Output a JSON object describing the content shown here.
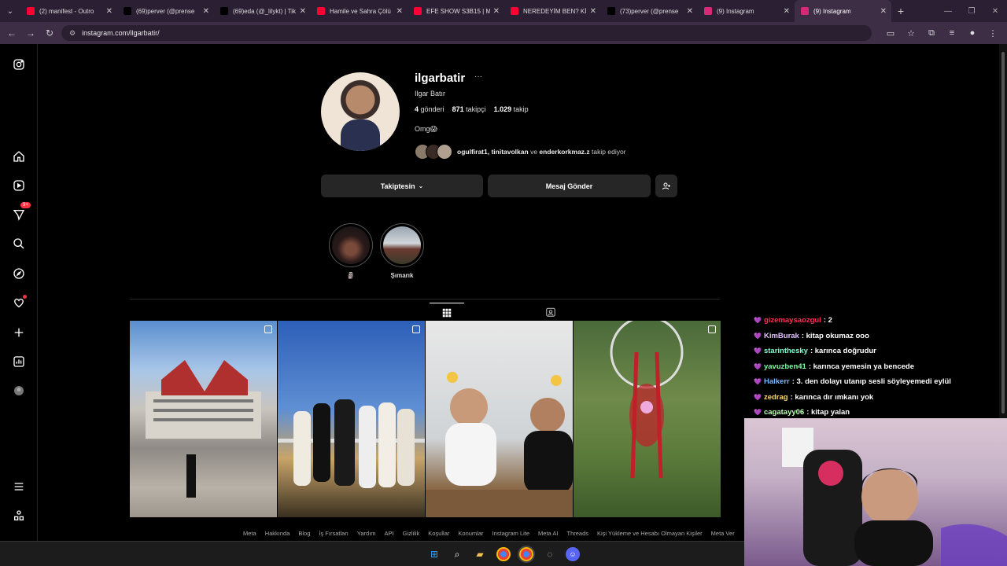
{
  "browser": {
    "tabs": [
      {
        "title": "(2) manifest - Outro",
        "favicon_color": "#ff0033",
        "active": false
      },
      {
        "title": "(69)perver (@prense",
        "favicon_color": "#000000",
        "active": false
      },
      {
        "title": "(69)eda (@_lilykt) | Tik",
        "favicon_color": "#000000",
        "active": false
      },
      {
        "title": "Hamile ve Sahra Çölü",
        "favicon_color": "#ff0033",
        "active": false
      },
      {
        "title": "EFE SHOW S3B15 | M",
        "favicon_color": "#ff0033",
        "active": false
      },
      {
        "title": "NEREDEYİM BEN? Kİ",
        "favicon_color": "#ff0033",
        "active": false
      },
      {
        "title": "(73)perver (@prense",
        "favicon_color": "#000000",
        "active": false
      },
      {
        "title": "(9) Instagram",
        "favicon_color": "#d62976",
        "active": false
      },
      {
        "title": "(9) Instagram",
        "favicon_color": "#d62976",
        "active": true
      }
    ],
    "url": "instagram.com/ilgarbatir/"
  },
  "sidebar": {
    "notification_badge": "9+"
  },
  "profile": {
    "username": "ilgarbatir",
    "full_name": "Ilgar Batır",
    "posts_count": "4",
    "posts_label": "gönderi",
    "followers_count": "871",
    "followers_label": "takipçi",
    "following_count": "1.029",
    "following_label": "takip",
    "bio": "Omg😱",
    "followed_by_names": "ogulfirat1, tinitavolkan",
    "followed_by_and": "ve",
    "followed_by_last": "enderkorkmaz.z",
    "followed_by_suffix": "takip ediyor",
    "follow_button": "Takiptesin",
    "message_button": "Mesaj Gönder"
  },
  "highlights": [
    {
      "label": "🗿"
    },
    {
      "label": "Şımarık"
    }
  ],
  "footer_links": [
    "Meta",
    "Hakkında",
    "Blog",
    "İş Fırsatları",
    "Yardım",
    "API",
    "Gizlilik",
    "Koşullar",
    "Konumlar",
    "Instagram Lite",
    "Meta AI",
    "Threads",
    "Kişi Yükleme ve Hesabı Olmayan Kişiler",
    "Meta Ver"
  ],
  "chat": [
    {
      "user": "gizemaysaozgul",
      "color": "#ff2d55",
      "message": ": 2"
    },
    {
      "user": "KimBurak",
      "color": "#e3c0ff",
      "message": ": kitap okumaz ooo"
    },
    {
      "user": "starinthesky",
      "color": "#7fffd4",
      "message": ": karınca doğrudur"
    },
    {
      "user": "yavuzben41",
      "color": "#7cfc9a",
      "message": ": karınca yemesin ya bencede"
    },
    {
      "user": "Halkerr",
      "color": "#7ab8ff",
      "message": ": 3. den dolayı utanıp sesli söyleyemedi eylül"
    },
    {
      "user": "zedrag",
      "color": "#ffd966",
      "message": ": karınca dır ımkanı yok"
    },
    {
      "user": "cagatayy06",
      "color": "#b8ffb0",
      "message": ": kitap yalan"
    }
  ]
}
